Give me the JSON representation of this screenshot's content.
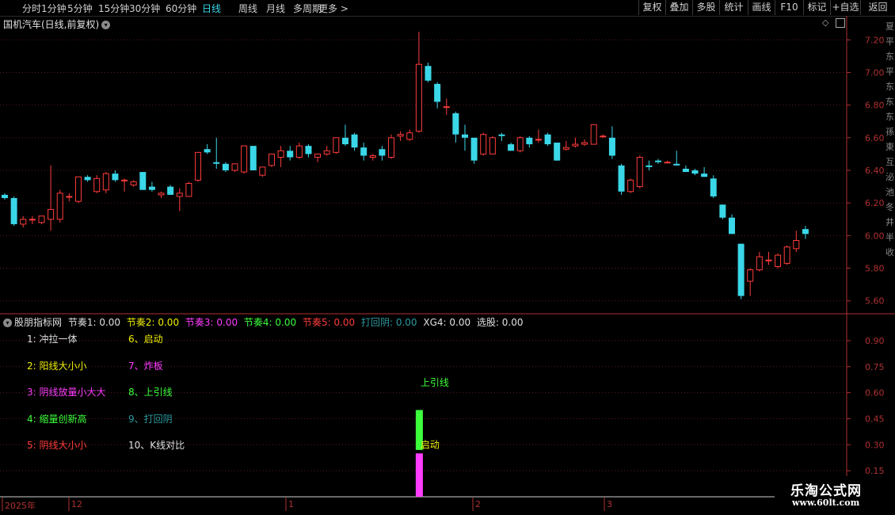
{
  "tabs": [
    {
      "label": "分时"
    },
    {
      "label": "1分钟"
    },
    {
      "label": "5分钟"
    },
    {
      "label": "15分钟"
    },
    {
      "label": "30分钟"
    },
    {
      "label": "60分钟"
    },
    {
      "label": "日线",
      "active": true
    },
    {
      "label": "周线"
    },
    {
      "label": "月线"
    },
    {
      "label": "多周期"
    },
    {
      "label": "更多 >"
    }
  ],
  "right_buttons": [
    {
      "label": "复权"
    },
    {
      "label": "叠加"
    },
    {
      "label": "多股"
    },
    {
      "label": "统计"
    },
    {
      "label": "画线"
    },
    {
      "label": "F10"
    },
    {
      "label": "标记"
    },
    {
      "label": "+自选"
    },
    {
      "label": "返回"
    }
  ],
  "chart_title": "国机汽车(日线,前复权)",
  "colors": {
    "up": "#ff3c3c",
    "down": "#3ad7e8",
    "axis": "#b03030",
    "grid": "#5a1a1a"
  },
  "chart_data": {
    "type": "candlestick",
    "price_axis": {
      "min": 5.55,
      "max": 7.25,
      "ticks": [
        "7.20",
        "7.00",
        "6.80",
        "6.60",
        "6.40",
        "6.20",
        "6.00",
        "5.80",
        "5.60"
      ]
    },
    "candles": [
      {
        "o": 6.25,
        "h": 6.26,
        "l": 6.22,
        "c": 6.23
      },
      {
        "o": 6.23,
        "h": 6.24,
        "l": 6.06,
        "c": 6.07
      },
      {
        "o": 6.07,
        "h": 6.12,
        "l": 6.05,
        "c": 6.1
      },
      {
        "o": 6.1,
        "h": 6.12,
        "l": 6.07,
        "c": 6.1
      },
      {
        "o": 6.08,
        "h": 6.12,
        "l": 6.07,
        "c": 6.12
      },
      {
        "o": 6.1,
        "h": 6.43,
        "l": 6.03,
        "c": 6.16
      },
      {
        "o": 6.1,
        "h": 6.28,
        "l": 6.08,
        "c": 6.26
      },
      {
        "o": 6.24,
        "h": 6.26,
        "l": 6.21,
        "c": 6.24
      },
      {
        "o": 6.21,
        "h": 6.36,
        "l": 6.2,
        "c": 6.36
      },
      {
        "o": 6.36,
        "h": 6.37,
        "l": 6.33,
        "c": 6.34
      },
      {
        "o": 6.27,
        "h": 6.37,
        "l": 6.26,
        "c": 6.35
      },
      {
        "o": 6.28,
        "h": 6.39,
        "l": 6.26,
        "c": 6.38
      },
      {
        "o": 6.38,
        "h": 6.4,
        "l": 6.33,
        "c": 6.34
      },
      {
        "o": 6.34,
        "h": 6.35,
        "l": 6.27,
        "c": 6.34
      },
      {
        "o": 6.31,
        "h": 6.34,
        "l": 6.3,
        "c": 6.33
      },
      {
        "o": 6.39,
        "h": 6.39,
        "l": 6.29,
        "c": 6.28
      },
      {
        "o": 6.3,
        "h": 6.33,
        "l": 6.27,
        "c": 6.28
      },
      {
        "o": 6.25,
        "h": 6.27,
        "l": 6.23,
        "c": 6.26
      },
      {
        "o": 6.3,
        "h": 6.31,
        "l": 6.25,
        "c": 6.25
      },
      {
        "o": 6.24,
        "h": 6.29,
        "l": 6.15,
        "c": 6.26
      },
      {
        "o": 6.24,
        "h": 6.33,
        "l": 6.24,
        "c": 6.32
      },
      {
        "o": 6.34,
        "h": 6.51,
        "l": 6.33,
        "c": 6.51
      },
      {
        "o": 6.53,
        "h": 6.56,
        "l": 6.5,
        "c": 6.51
      },
      {
        "o": 6.45,
        "h": 6.6,
        "l": 6.41,
        "c": 6.44
      },
      {
        "o": 6.44,
        "h": 6.45,
        "l": 6.39,
        "c": 6.4
      },
      {
        "o": 6.4,
        "h": 6.44,
        "l": 6.39,
        "c": 6.44
      },
      {
        "o": 6.39,
        "h": 6.55,
        "l": 6.38,
        "c": 6.55
      },
      {
        "o": 6.55,
        "h": 6.55,
        "l": 6.4,
        "c": 6.4
      },
      {
        "o": 6.37,
        "h": 6.42,
        "l": 6.36,
        "c": 6.42
      },
      {
        "o": 6.43,
        "h": 6.5,
        "l": 6.42,
        "c": 6.5
      },
      {
        "o": 6.48,
        "h": 6.55,
        "l": 6.42,
        "c": 6.52
      },
      {
        "o": 6.52,
        "h": 6.55,
        "l": 6.46,
        "c": 6.48
      },
      {
        "o": 6.48,
        "h": 6.57,
        "l": 6.47,
        "c": 6.55
      },
      {
        "o": 6.55,
        "h": 6.56,
        "l": 6.48,
        "c": 6.5
      },
      {
        "o": 6.48,
        "h": 6.5,
        "l": 6.45,
        "c": 6.5
      },
      {
        "o": 6.5,
        "h": 6.55,
        "l": 6.49,
        "c": 6.52
      },
      {
        "o": 6.51,
        "h": 6.6,
        "l": 6.5,
        "c": 6.6
      },
      {
        "o": 6.6,
        "h": 6.68,
        "l": 6.55,
        "c": 6.56
      },
      {
        "o": 6.62,
        "h": 6.63,
        "l": 6.52,
        "c": 6.54
      },
      {
        "o": 6.54,
        "h": 6.57,
        "l": 6.46,
        "c": 6.49
      },
      {
        "o": 6.48,
        "h": 6.5,
        "l": 6.46,
        "c": 6.49
      },
      {
        "o": 6.53,
        "h": 6.55,
        "l": 6.46,
        "c": 6.49
      },
      {
        "o": 6.48,
        "h": 6.62,
        "l": 6.47,
        "c": 6.6
      },
      {
        "o": 6.61,
        "h": 6.64,
        "l": 6.58,
        "c": 6.62
      },
      {
        "o": 6.59,
        "h": 6.65,
        "l": 6.58,
        "c": 6.63
      },
      {
        "o": 6.64,
        "h": 7.25,
        "l": 6.63,
        "c": 7.05
      },
      {
        "o": 7.04,
        "h": 7.06,
        "l": 6.94,
        "c": 6.95
      },
      {
        "o": 6.93,
        "h": 6.94,
        "l": 6.78,
        "c": 6.82
      },
      {
        "o": 6.79,
        "h": 6.84,
        "l": 6.74,
        "c": 6.79
      },
      {
        "o": 6.75,
        "h": 6.76,
        "l": 6.57,
        "c": 6.62
      },
      {
        "o": 6.62,
        "h": 6.68,
        "l": 6.52,
        "c": 6.6
      },
      {
        "o": 6.6,
        "h": 6.6,
        "l": 6.44,
        "c": 6.46
      },
      {
        "o": 6.5,
        "h": 6.63,
        "l": 6.49,
        "c": 6.62
      },
      {
        "o": 6.5,
        "h": 6.61,
        "l": 6.5,
        "c": 6.6
      },
      {
        "o": 6.62,
        "h": 6.63,
        "l": 6.58,
        "c": 6.61
      },
      {
        "o": 6.56,
        "h": 6.57,
        "l": 6.52,
        "c": 6.52
      },
      {
        "o": 6.52,
        "h": 6.61,
        "l": 6.51,
        "c": 6.6
      },
      {
        "o": 6.6,
        "h": 6.61,
        "l": 6.54,
        "c": 6.56
      },
      {
        "o": 6.59,
        "h": 6.65,
        "l": 6.57,
        "c": 6.59
      },
      {
        "o": 6.62,
        "h": 6.63,
        "l": 6.55,
        "c": 6.56
      },
      {
        "o": 6.57,
        "h": 6.57,
        "l": 6.46,
        "c": 6.46
      },
      {
        "o": 6.53,
        "h": 6.58,
        "l": 6.52,
        "c": 6.54
      },
      {
        "o": 6.55,
        "h": 6.6,
        "l": 6.54,
        "c": 6.56
      },
      {
        "o": 6.56,
        "h": 6.59,
        "l": 6.55,
        "c": 6.57
      },
      {
        "o": 6.56,
        "h": 6.68,
        "l": 6.56,
        "c": 6.68
      },
      {
        "o": 6.61,
        "h": 6.62,
        "l": 6.6,
        "c": 6.61
      },
      {
        "o": 6.6,
        "h": 6.67,
        "l": 6.47,
        "c": 6.49
      },
      {
        "o": 6.43,
        "h": 6.44,
        "l": 6.25,
        "c": 6.27
      },
      {
        "o": 6.27,
        "h": 6.35,
        "l": 6.26,
        "c": 6.34
      },
      {
        "o": 6.3,
        "h": 6.49,
        "l": 6.29,
        "c": 6.48
      },
      {
        "o": 6.43,
        "h": 6.46,
        "l": 6.4,
        "c": 6.42
      },
      {
        "o": 6.46,
        "h": 6.47,
        "l": 6.44,
        "c": 6.45
      },
      {
        "o": 6.45,
        "h": 6.46,
        "l": 6.45,
        "c": 6.45
      },
      {
        "o": 6.44,
        "h": 6.52,
        "l": 6.43,
        "c": 6.43
      },
      {
        "o": 6.41,
        "h": 6.43,
        "l": 6.39,
        "c": 6.39
      },
      {
        "o": 6.4,
        "h": 6.41,
        "l": 6.37,
        "c": 6.38
      },
      {
        "o": 6.38,
        "h": 6.42,
        "l": 6.36,
        "c": 6.36
      },
      {
        "o": 6.35,
        "h": 6.37,
        "l": 6.23,
        "c": 6.24
      },
      {
        "o": 6.19,
        "h": 6.19,
        "l": 6.1,
        "c": 6.11
      },
      {
        "o": 6.11,
        "h": 6.13,
        "l": 6.01,
        "c": 6.01
      },
      {
        "o": 5.95,
        "h": 5.95,
        "l": 5.61,
        "c": 5.63
      },
      {
        "o": 5.72,
        "h": 5.8,
        "l": 5.63,
        "c": 5.79
      },
      {
        "o": 5.79,
        "h": 5.9,
        "l": 5.78,
        "c": 5.87
      },
      {
        "o": 5.85,
        "h": 5.9,
        "l": 5.82,
        "c": 5.85
      },
      {
        "o": 5.81,
        "h": 5.89,
        "l": 5.8,
        "c": 5.88
      },
      {
        "o": 5.83,
        "h": 5.94,
        "l": 5.82,
        "c": 5.93
      },
      {
        "o": 5.92,
        "h": 6.03,
        "l": 5.9,
        "c": 5.97
      },
      {
        "o": 6.04,
        "h": 6.06,
        "l": 5.98,
        "c": 6.01
      }
    ],
    "dates": [
      "2025年",
      "12",
      "1",
      "2",
      "3"
    ],
    "indicator": {
      "name": "股朋指标网",
      "values": [
        {
          "label": "节奏1:",
          "value": "0.00",
          "color": "#e0e0e0"
        },
        {
          "label": "节奏2:",
          "value": "0.00",
          "color": "#f0f000"
        },
        {
          "label": "节奏3:",
          "value": "0.00",
          "color": "#ff3cff"
        },
        {
          "label": "节奏4:",
          "value": "0.00",
          "color": "#3cff3c"
        },
        {
          "label": "节奏5:",
          "value": "0.00",
          "color": "#ff3c3c"
        },
        {
          "label": "打回阴:",
          "value": "0.00",
          "color": "#2a9aa0"
        },
        {
          "label": "XG4:",
          "value": "0.00",
          "color": "#e0e0e0"
        },
        {
          "label": "选股:",
          "value": "0.00",
          "color": "#e0e0e0"
        }
      ],
      "axis_ticks": [
        "0.90",
        "0.75",
        "0.60",
        "0.45",
        "0.30",
        "0.15"
      ],
      "bars": [
        {
          "index": 45,
          "from": 0.27,
          "to": 0.5,
          "color": "#3cff3c"
        },
        {
          "index": 45,
          "from": 0.0,
          "to": 0.25,
          "color": "#ff3cff"
        }
      ],
      "labels": [
        {
          "text": "上引线",
          "index": 45,
          "value": 0.64,
          "color": "#3cff3c"
        },
        {
          "text": "启动",
          "index": 45,
          "value": 0.28,
          "color": "#f0f000"
        }
      ]
    },
    "legend": [
      {
        "text": "1: 冲拉一体",
        "color": "#e0e0e0"
      },
      {
        "text": "6、启动",
        "color": "#f0f000"
      },
      {
        "text": "2: 阳线大小小",
        "color": "#f0f000"
      },
      {
        "text": "7、炸板",
        "color": "#ff3cff"
      },
      {
        "text": "3: 阴线放量小大大",
        "color": "#ff3cff"
      },
      {
        "text": "8、上引线",
        "color": "#3cff3c"
      },
      {
        "text": "4: 缩量创新高",
        "color": "#3cff3c"
      },
      {
        "text": "9、打回阴",
        "color": "#2a9aa0"
      },
      {
        "text": "5: 阴线大小小",
        "color": "#ff3c3c"
      },
      {
        "text": "10、K线对比",
        "color": "#e0e0e0"
      }
    ]
  },
  "watermark": {
    "line1": "乐淘公式网",
    "line2": "www.60lt.com"
  }
}
